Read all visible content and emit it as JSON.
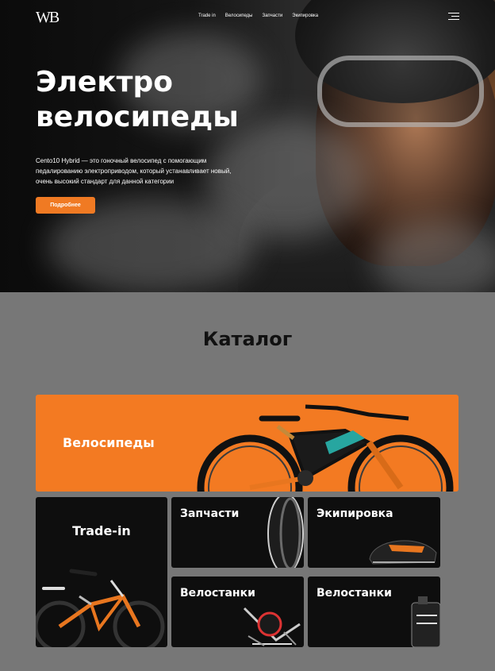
{
  "header": {
    "logo_text": "WB",
    "nav": [
      "Trade in",
      "Велосипеды",
      "Запчасти",
      "Экипировка"
    ]
  },
  "hero": {
    "title_line1": "Электро",
    "title_line2": "велосипеды",
    "description": "Cento10 Hybrid — это гоночный велосипед с помогающим педалированию электроприводом, который устанавливает новый, очень высокий стандарт для данной категории",
    "button_label": "Подробнее"
  },
  "catalog": {
    "title": "Каталог",
    "cards": {
      "bikes": "Велосипеды",
      "trade_in": "Trade-in",
      "parts": "Запчасти",
      "equipment": "Экипировка",
      "stands_1": "Велостанки",
      "stands_2": "Велостанки"
    }
  },
  "colors": {
    "accent": "#f37a22",
    "page_bg": "#777777",
    "card_dark": "#0e0e0e"
  },
  "icons": [
    "menu-icon",
    "logo"
  ]
}
